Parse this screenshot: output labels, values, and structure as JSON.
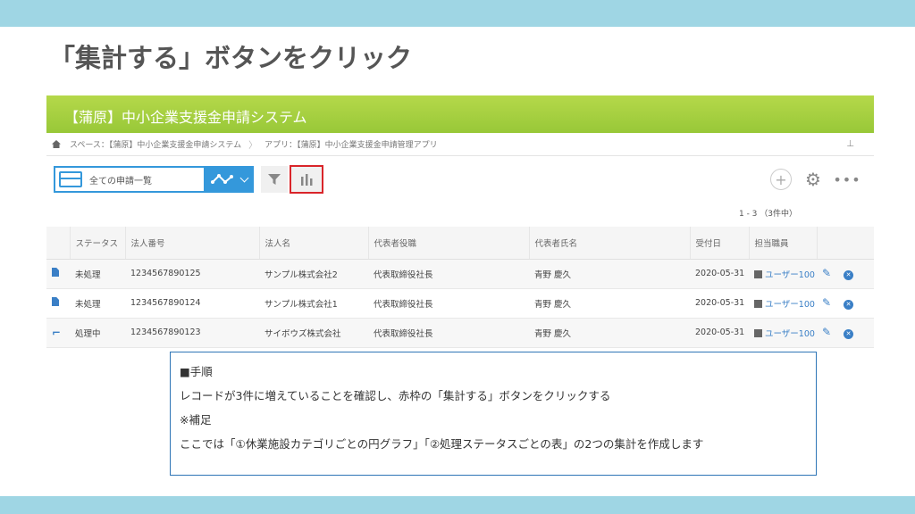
{
  "slide": {
    "title": "「集計する」ボタンをクリック"
  },
  "app": {
    "header_title": "【蒲原】中小企業支援金申請システム",
    "breadcrumb": [
      "スペース：【蒲原】中小企業支援金申請システム",
      "アプリ：【蒲原】中小企業支援金申請管理アプリ"
    ],
    "view_select_label": "全ての申請一覧",
    "record_count": "1 - 3 （3件中）",
    "columns": [
      "ステータス",
      "法人番号",
      "法人名",
      "代表者役職",
      "代表者氏名",
      "受付日",
      "担当職員"
    ],
    "rows": [
      {
        "icon": "document-icon",
        "status": "未処理",
        "number": "1234567890125",
        "company": "サンプル株式会社2",
        "title": "代表取締役社長",
        "rep": "青野 慶久",
        "date": "2020-05-31",
        "staff": "ユーザー100"
      },
      {
        "icon": "document-icon",
        "status": "未処理",
        "number": "1234567890124",
        "company": "サンプル株式会社1",
        "title": "代表取締役社長",
        "rep": "青野 慶久",
        "date": "2020-05-31",
        "staff": "ユーザー100"
      },
      {
        "icon": "process-icon",
        "status": "処理中",
        "number": "1234567890123",
        "company": "サイボウズ株式会社",
        "title": "代表取締役社長",
        "rep": "青野 慶久",
        "date": "2020-05-31",
        "staff": "ユーザー100"
      }
    ]
  },
  "note": {
    "heading": "■手順",
    "step": "レコードが3件に増えていることを確認し、赤枠の「集計する」ボタンをクリックする",
    "supplement_heading": "※補足",
    "supplement": "ここでは「①休業施設カテゴリごとの円グラフ」「②処理ステータスごとの表」の2つの集計を作成します"
  },
  "colors": {
    "band": "#9fd6e4",
    "header_green": "#a8d040",
    "accent_blue": "#3498db",
    "highlight_red": "#d9252a"
  }
}
